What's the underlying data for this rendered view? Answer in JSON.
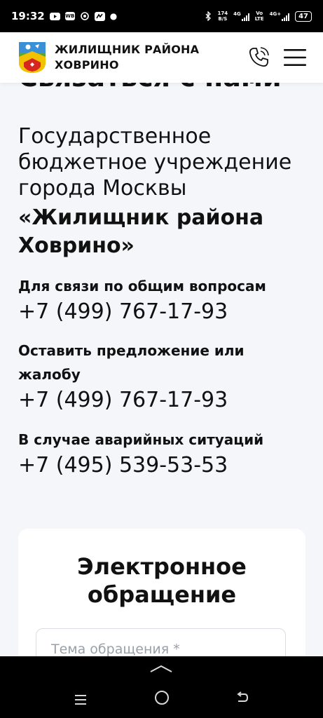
{
  "status_bar": {
    "time": "19:32",
    "net_speed_top": "174",
    "net_speed_bottom": "B/S",
    "net1": "4G",
    "volte_top": "Vo",
    "volte_bottom": "LTE",
    "net2": "4G+",
    "battery": "47"
  },
  "header": {
    "brand_line1": "ЖИЛИЩНИК РАЙОНА",
    "brand_line2": "ХОВРИНО",
    "icons": [
      "coat-of-arms-logo",
      "phone-icon",
      "hamburger-menu-icon"
    ]
  },
  "page": {
    "section_title": "Связаться с нами",
    "org_plain": "Государственное бюджетное учреждение города Москвы",
    "org_bold": "«Жилищник района Ховрино»",
    "contacts": [
      {
        "label": "Для связи по общим вопросам",
        "phone": "+7 (499) 767-17-93"
      },
      {
        "label": "Оставить предложение или жалобу",
        "phone": "+7 (499) 767-17-93"
      },
      {
        "label": "В случае аварийных ситуаций",
        "phone": "+7 (495) 539-53-53"
      }
    ]
  },
  "form": {
    "title": "Электронное обращение",
    "subject_placeholder": "Тема обращения *"
  },
  "colors": {
    "page_bg": "#f4f6fa",
    "logo_green": "#5aa33b",
    "logo_yellow": "#f2c200",
    "logo_red": "#d7261e",
    "logo_blue": "#3b8fd4"
  }
}
